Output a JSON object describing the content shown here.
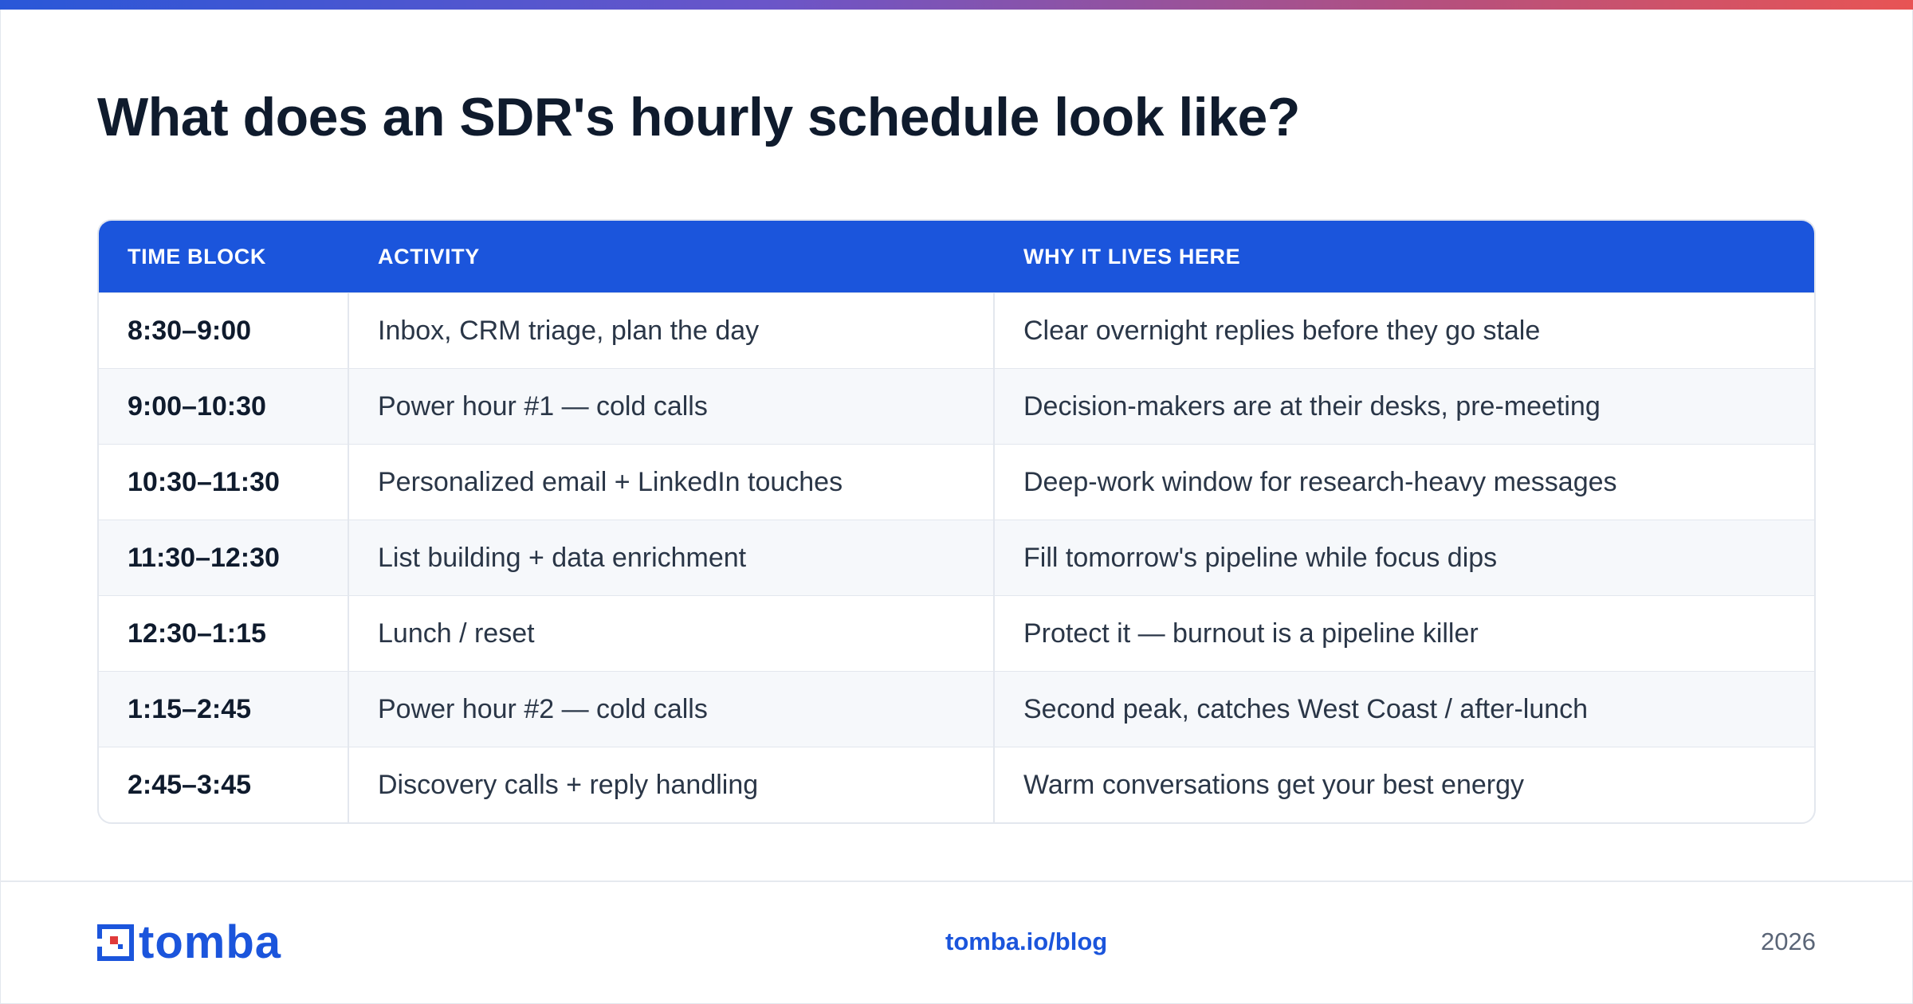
{
  "title": "What does an SDR's hourly schedule look like?",
  "colors": {
    "accent": "#1b55dc",
    "brand_red": "#e03a3a"
  },
  "table": {
    "headers": [
      "TIME BLOCK",
      "ACTIVITY",
      "WHY IT LIVES HERE"
    ],
    "rows": [
      [
        "8:30–9:00",
        "Inbox, CRM triage, plan the day",
        "Clear overnight replies before they go stale"
      ],
      [
        "9:00–10:30",
        "Power hour #1 — cold calls",
        "Decision-makers are at their desks, pre-meeting"
      ],
      [
        "10:30–11:30",
        "Personalized email + LinkedIn touches",
        "Deep-work window for research-heavy messages"
      ],
      [
        "11:30–12:30",
        "List building + data enrichment",
        "Fill tomorrow's pipeline while focus dips"
      ],
      [
        "12:30–1:15",
        "Lunch / reset",
        "Protect it — burnout is a pipeline killer"
      ],
      [
        "1:15–2:45",
        "Power hour #2 — cold calls",
        "Second peak, catches West Coast / after-lunch"
      ],
      [
        "2:45–3:45",
        "Discovery calls + reply handling",
        "Warm conversations get your best energy"
      ]
    ]
  },
  "footer": {
    "logo_text": "tomba",
    "url": "tomba.io/blog",
    "year": "2026"
  }
}
